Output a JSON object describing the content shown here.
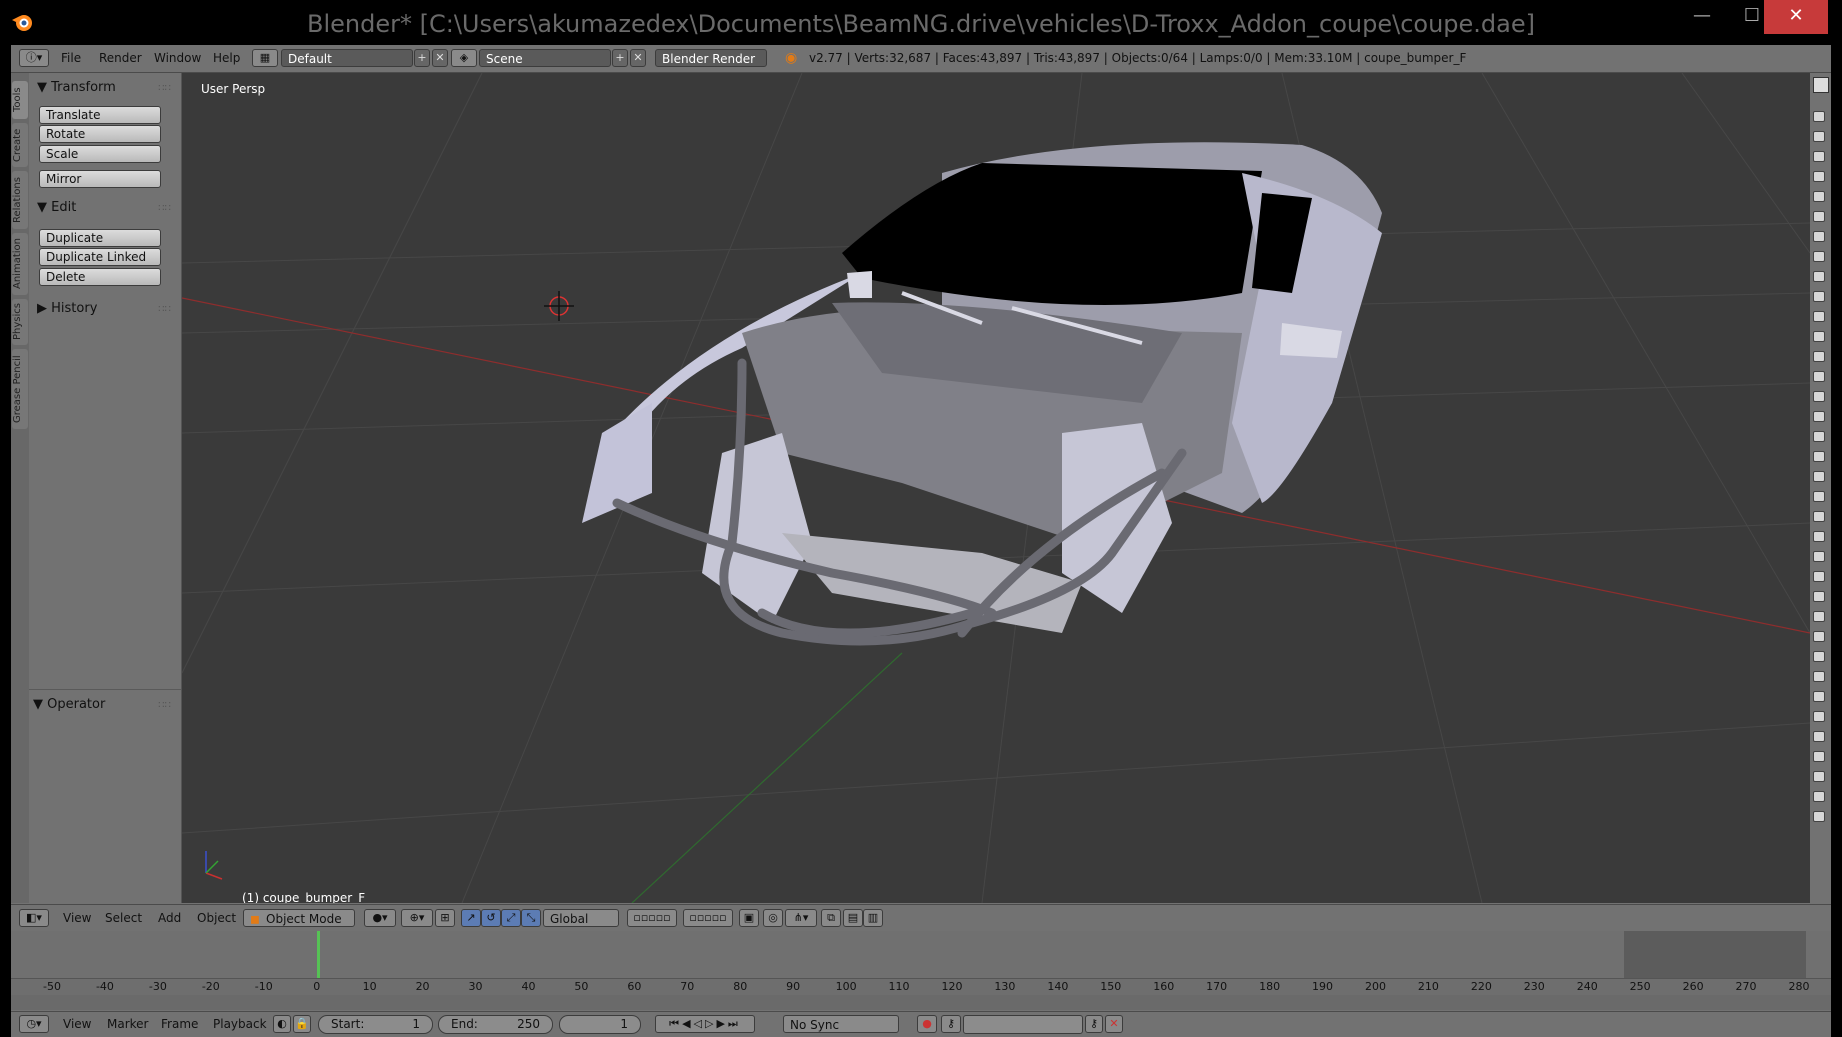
{
  "window": {
    "title": "Blender* [C:\\Users\\akumazedex\\Documents\\BeamNG.drive\\vehicles\\D-Troxx_Addon_coupe\\coupe.dae]",
    "minimize": "—",
    "maximize": "☐",
    "close": "✕"
  },
  "infobar": {
    "menus": [
      "File",
      "Render",
      "Window",
      "Help"
    ],
    "screen_layout": "Default",
    "scene": "Scene",
    "render_engine": "Blender Render",
    "stats": "v2.77 | Verts:32,687 | Faces:43,897 | Tris:43,897 | Objects:0/64 | Lamps:0/0 | Mem:33.10M | coupe_bumper_F"
  },
  "toolshelf": {
    "tabs": [
      "Tools",
      "Create",
      "Relations",
      "Animation",
      "Physics",
      "Grease Pencil"
    ],
    "transform": {
      "title": "Transform",
      "buttons": [
        "Translate",
        "Rotate",
        "Scale",
        "Mirror"
      ]
    },
    "edit": {
      "title": "Edit",
      "buttons": [
        "Duplicate",
        "Duplicate Linked",
        "Delete"
      ]
    },
    "history": {
      "title": "History"
    },
    "operator": {
      "title": "Operator"
    }
  },
  "viewport": {
    "view_label": "User Persp",
    "active_object": "(1) coupe_bumper_F"
  },
  "view3d_header": {
    "menus": [
      "View",
      "Select",
      "Add",
      "Object"
    ],
    "mode": "Object Mode",
    "orientation": "Global"
  },
  "timeline": {
    "ticks": [
      "-50",
      "-40",
      "-30",
      "-20",
      "-10",
      "0",
      "10",
      "20",
      "30",
      "40",
      "50",
      "60",
      "70",
      "80",
      "90",
      "100",
      "110",
      "120",
      "130",
      "140",
      "150",
      "160",
      "170",
      "180",
      "190",
      "200",
      "210",
      "220",
      "230",
      "240",
      "250",
      "260",
      "270",
      "280"
    ],
    "menus": [
      "View",
      "Marker",
      "Frame",
      "Playback"
    ],
    "start_label": "Start:",
    "start_value": "1",
    "end_label": "End:",
    "end_value": "250",
    "current_frame": "1",
    "sync": "No Sync"
  },
  "colors": {
    "viewport_bg": "#3a3a3a",
    "panel_bg": "#727272",
    "x_axis": "#9a2a2a",
    "y_axis": "#2f6f2f",
    "car_body": "#c6c6d8",
    "current_frame": "#56c255"
  }
}
